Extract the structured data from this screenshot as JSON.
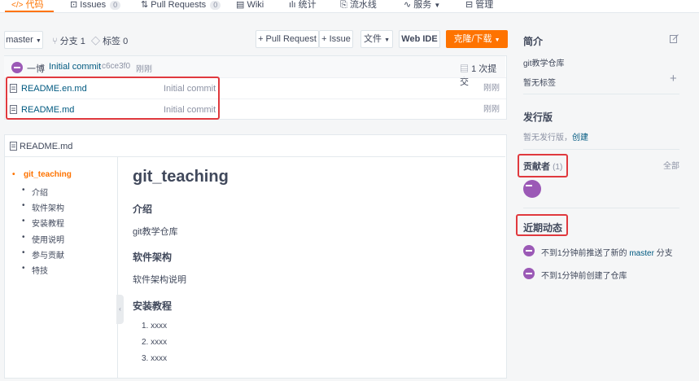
{
  "nav": {
    "tabs": [
      {
        "label": "代码"
      },
      {
        "label": "Issues",
        "count": "0"
      },
      {
        "label": "Pull Requests",
        "count": "0"
      },
      {
        "label": "Wiki"
      },
      {
        "label": "统计"
      },
      {
        "label": "流水线"
      },
      {
        "label": "服务"
      },
      {
        "label": "管理"
      }
    ]
  },
  "toolbar": {
    "branch": "master",
    "branches": "分支 1",
    "tags": "标签 0",
    "pull_request": "+ Pull Request",
    "issue": "+ Issue",
    "file": "文件",
    "web_ide": "Web IDE",
    "clone": "克隆/下载"
  },
  "commit": {
    "author": "一博",
    "message": "Initial commit",
    "hash": "c6ce3f0",
    "time": "刚刚",
    "count": "1 次提交"
  },
  "files": [
    {
      "name": "README.en.md",
      "message": "Initial commit",
      "time": "刚刚"
    },
    {
      "name": "README.md",
      "message": "Initial commit",
      "time": "刚刚"
    }
  ],
  "readme": {
    "header": "README.md",
    "toc": [
      {
        "label": "git_teaching"
      },
      {
        "label": "介绍"
      },
      {
        "label": "软件架构"
      },
      {
        "label": "安装教程"
      },
      {
        "label": "使用说明"
      },
      {
        "label": "参与贡献"
      },
      {
        "label": "特技"
      }
    ],
    "title": "git_teaching",
    "sections": {
      "intro_h": "介绍",
      "intro_p": "git教学仓库",
      "arch_h": "软件架构",
      "arch_p": "软件架构说明",
      "install_h": "安装教程"
    },
    "install_steps": [
      "1. xxxx",
      "2. xxxx",
      "3. xxxx"
    ]
  },
  "sidebar": {
    "intro_title": "简介",
    "description": "git教学仓库",
    "no_tags": "暂无标签",
    "releases_title": "发行版",
    "no_releases": "暂无发行版，",
    "create": "创建",
    "contributors_title": "贡献者",
    "contributors_count": "(1)",
    "all": "全部",
    "activity_title": "近期动态",
    "activities": [
      {
        "pre": "不到1分钟前推送了新的 ",
        "branch": "master",
        "post": " 分支"
      },
      {
        "pre": "不到1分钟前创建了仓库",
        "branch": "",
        "post": ""
      }
    ]
  },
  "colors": {
    "accent": "#fe7300",
    "link": "#005980",
    "highlight_box": "#e0393e",
    "avatar": "#9b59b6"
  }
}
